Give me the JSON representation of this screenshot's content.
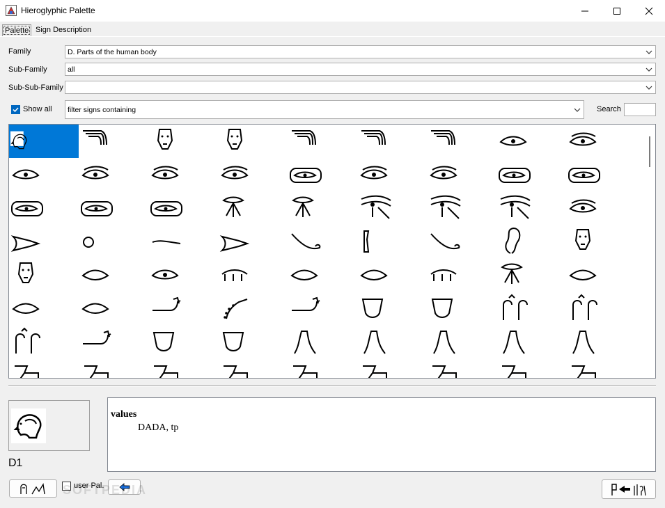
{
  "window": {
    "title": "Hieroglyphic Palette"
  },
  "tabs": [
    {
      "label": "Palette"
    },
    {
      "label": "Sign Description"
    }
  ],
  "filters": {
    "family_label": "Family",
    "family_value": "D. Parts of the human body",
    "subfamily_label": "Sub-Family",
    "subfamily_value": "all",
    "subsubfamily_label": "Sub-Sub-Family",
    "subsubfamily_value": "",
    "show_all_label": "Show all",
    "show_all_checked": true,
    "filter_value": "filter signs containing",
    "search_label": "Search",
    "search_value": ""
  },
  "palette": {
    "selected_index": 0,
    "signs": [
      "D1",
      "D2",
      "D3",
      "D4",
      "D5",
      "D6",
      "D7",
      "D8",
      "D9",
      "D10",
      "D11",
      "D12",
      "D13",
      "D14",
      "D15",
      "D16",
      "D17",
      "D18",
      "D19",
      "D20",
      "D21",
      "D22",
      "D23",
      "D24",
      "D25",
      "D26",
      "D27",
      "D28",
      "D29",
      "D30",
      "D31",
      "D32",
      "D33",
      "D34",
      "D35",
      "D36",
      "D37",
      "D38",
      "D39",
      "D40",
      "D41",
      "D42",
      "D43",
      "D44",
      "D45",
      "D46",
      "D47",
      "D48",
      "D49",
      "D50",
      "D51",
      "D52",
      "D53",
      "D54",
      "D55",
      "D56",
      "D57",
      "D58",
      "D59",
      "D60",
      "D61",
      "D62",
      "D63",
      "D64",
      "D65",
      "D66",
      "D67",
      "D68",
      "D69",
      "D70",
      "D71",
      "D72"
    ]
  },
  "details": {
    "sign_code": "D1",
    "values_heading": "values",
    "values_text": "DADA, tp"
  },
  "footer": {
    "user_pal_label": "user Pal.",
    "user_pal_checked": false
  },
  "watermark": "SOFTPEDIA",
  "colors": {
    "selection": "#0078d7",
    "checkbox": "#0067c0"
  }
}
